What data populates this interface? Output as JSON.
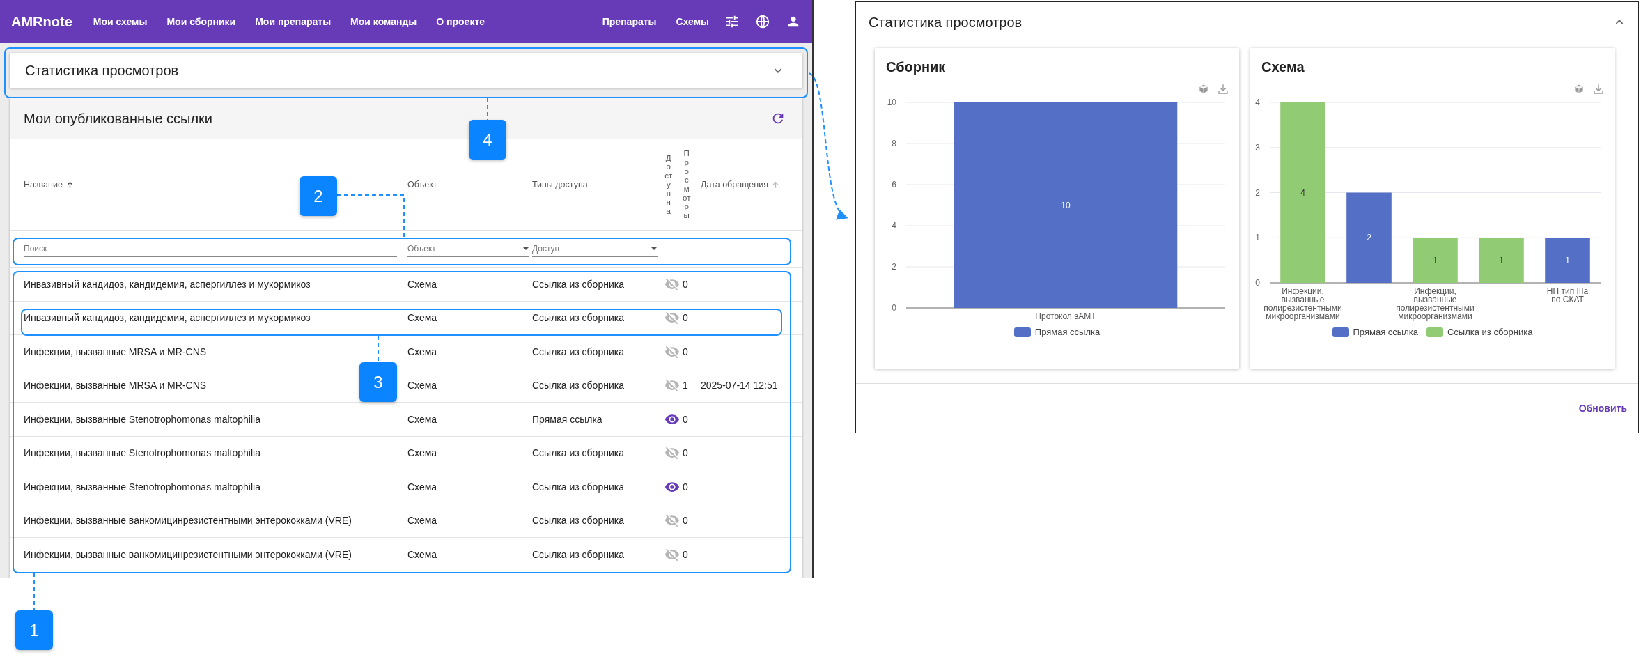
{
  "navbar": {
    "logo": "AMRnote",
    "links": [
      "Мои схемы",
      "Мои сборники",
      "Мои препараты",
      "Мои команды",
      "О проекте"
    ],
    "right_links": [
      "Препараты",
      "Схемы"
    ]
  },
  "stats_header": {
    "title": "Статистика просмотров",
    "expanded": false
  },
  "links_table": {
    "title": "Мои опубликованные ссылки",
    "columns": [
      {
        "label": "Название",
        "kind": "text",
        "sort_active": true
      },
      {
        "label": "Объект",
        "kind": "text"
      },
      {
        "label": "Типы доступа",
        "kind": "text"
      },
      {
        "label": "Доступна",
        "kind": "vertical"
      },
      {
        "label": "Просмотры",
        "kind": "vertical"
      },
      {
        "label": "Дата обращения",
        "kind": "text",
        "sort_active": false
      }
    ],
    "filters": {
      "search_placeholder": "Поиск",
      "object_placeholder": "Объект",
      "access_placeholder": "Доступ"
    },
    "rows": [
      {
        "name": "Инвазивный кандидоз, кандидемия, аспергиллез и мукормикоз",
        "object": "Схема",
        "access": "Ссылка из сборника",
        "available": false,
        "views": "0"
      },
      {
        "name": "Инвазивный кандидоз, кандидемия, аспергиллез и мукормикоз",
        "object": "Схема",
        "access": "Ссылка из сборника",
        "available": false,
        "views": "0"
      },
      {
        "name": "Инфекции, вызванные MRSA и MR-CNS",
        "object": "Схема",
        "access": "Ссылка из сборника",
        "available": false,
        "views": "0"
      },
      {
        "name": "Инфекции, вызванные MRSA и MR-CNS",
        "object": "Схема",
        "access": "Ссылка из сборника",
        "available": false,
        "views": "1",
        "date": "2025-07-14 12:51"
      },
      {
        "name": "Инфекции, вызванные Stenotrophomonas maltophilia",
        "object": "Схема",
        "access": "Прямая ссылка",
        "available": true,
        "views": "0"
      },
      {
        "name": "Инфекции, вызванные Stenotrophomonas maltophilia",
        "object": "Схема",
        "access": "Ссылка из сборника",
        "available": false,
        "views": "0"
      },
      {
        "name": "Инфекции, вызванные Stenotrophomonas maltophilia",
        "object": "Схема",
        "access": "Ссылка из сборника",
        "available": true,
        "views": "0"
      },
      {
        "name": "Инфекции, вызванные ванкомицинрезистентными энтерококками (VRE)",
        "object": "Схема",
        "access": "Ссылка из сборника",
        "available": false,
        "views": "0"
      },
      {
        "name": "Инфекции, вызванные ванкомицинрезистентными энтерококками (VRE)",
        "object": "Схема",
        "access": "Ссылка из сборника",
        "available": false,
        "views": "0"
      }
    ]
  },
  "stats_panel": {
    "title": "Статистика просмотров",
    "expanded": true,
    "charts": [
      {
        "title": "Сборник",
        "chart_data": {
          "type": "bar",
          "categories": [
            "Протокол эАМТ"
          ],
          "series": [
            {
              "name": "Прямая ссылка",
              "color": "#5470c6",
              "values": [
                10
              ]
            }
          ],
          "ylim": [
            0,
            10
          ],
          "yticks": [
            0,
            2,
            4,
            6,
            8,
            10
          ],
          "grid": true,
          "data_labels": true
        }
      },
      {
        "title": "Схема",
        "chart_data": {
          "type": "bar",
          "categories": [
            "Инфекции, вызванные полирезистентными микроорганизмами",
            null,
            "Инфекции, вызванные полирезистентными микроорганизмами",
            null,
            "НП тип IIIa по СКАТ"
          ],
          "series": [
            {
              "name": "Прямая ссылка",
              "color": "#5470c6",
              "values": [
                null,
                2,
                null,
                null,
                1
              ]
            },
            {
              "name": "Ссылка из сборника",
              "color": "#91cc75",
              "values": [
                4,
                null,
                1,
                1,
                null
              ]
            }
          ],
          "stacked": true,
          "ylim": [
            0,
            4
          ],
          "yticks": [
            0,
            1,
            2,
            3,
            4
          ],
          "grid": true,
          "data_labels": true
        }
      }
    ],
    "refresh": "Обновить"
  },
  "annotations": [
    {
      "number": "4"
    },
    {
      "number": "2"
    },
    {
      "number": "3"
    },
    {
      "number": "1"
    }
  ]
}
